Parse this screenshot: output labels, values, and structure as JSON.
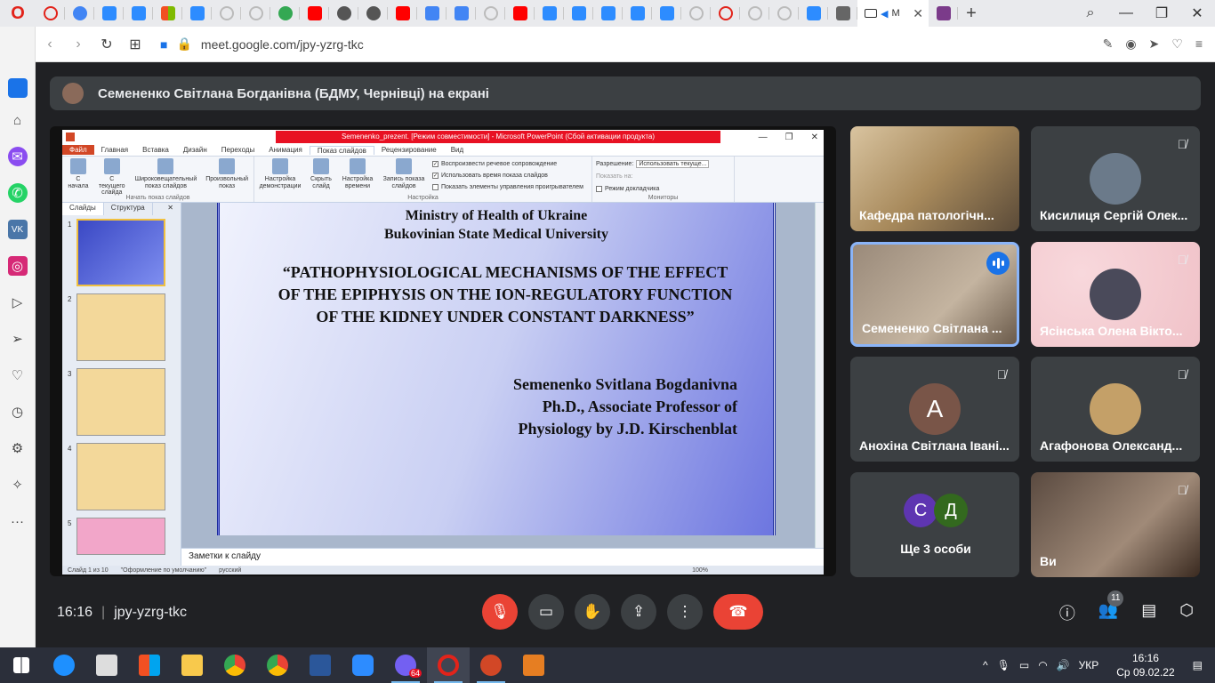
{
  "browser": {
    "active_tab_label": "М",
    "url": "meet.google.com/jpy-yzrg-tkc"
  },
  "meet": {
    "presenter_banner": "Семененко Світлана Богданівна (БДМУ, Чернівці) на екрані",
    "meeting_time": "16:16",
    "meeting_code": "jpy-yzrg-tkc",
    "participant_count": "11",
    "participants": [
      {
        "name": "Кафедра патологічн...",
        "avatar": "",
        "muted": false
      },
      {
        "name": "Кисилиця Сергій Олек...",
        "avatar": "",
        "muted": true
      },
      {
        "name": "Семененко Світлана ...",
        "avatar": "",
        "muted": false,
        "speaking": true
      },
      {
        "name": "Ясінська Олена Вікто...",
        "avatar": "",
        "muted": true
      },
      {
        "name": "Анохіна Світлана Івані...",
        "avatar": "А",
        "muted": true
      },
      {
        "name": "Агафонова Олександ...",
        "avatar": "",
        "muted": true
      },
      {
        "name": "Ще 3 особи",
        "avatar": "",
        "muted": false
      },
      {
        "name": "Ви",
        "avatar": "",
        "muted": true
      }
    ],
    "more_avatars": [
      "С",
      "Д"
    ]
  },
  "powerpoint": {
    "window_title": "Semenenko_prezent. [Режим совместимости] - Microsoft PowerPoint (Сбой активации продукта)",
    "menus": [
      "Файл",
      "Главная",
      "Вставка",
      "Дизайн",
      "Переходы",
      "Анимация",
      "Показ слайдов",
      "Рецензирование",
      "Вид"
    ],
    "ribbon_buttons": [
      "С начала",
      "С текущего слайда",
      "Широковещательный показ слайдов",
      "Произвольный показ",
      "Настройка демонстрации",
      "Скрыть слайд",
      "Настройка времени",
      "Запись показа слайдов"
    ],
    "ribbon_checks": [
      "Воспроизвести речевое сопровождение",
      "Использовать время показа слайдов",
      "Показать элементы управления проигрывателем"
    ],
    "group_start": "Начать показ слайдов",
    "group_setup": "Настройка",
    "group_monitors": "Мониторы",
    "resolution_label": "Разрешение:",
    "resolution_value": "Использовать текуще...",
    "show_on_label": "Показать на:",
    "presenter_mode": "Режим докладчика",
    "panel_tabs": [
      "Слайды",
      "Структура"
    ],
    "slide_numbers": [
      "1",
      "2",
      "3",
      "4",
      "5"
    ],
    "slide": {
      "institution_1": "Ministry of Health of Ukraine",
      "institution_2": "Bukovinian State Medical University",
      "title": "“PATHOPHYSIOLOGICAL MECHANISMS OF THE EFFECT OF THE EPIPHYSIS ON THE ION-REGULATORY FUNCTION OF THE KIDNEY UNDER CONSTANT DARKNESS”",
      "author_1": "Semenenko Svitlana Bogdanivna",
      "author_2": "Ph.D., Associate Professor of",
      "author_3": "Physiology by J.D. Kirschenblat"
    },
    "notes_placeholder": "Заметки к слайду",
    "status_slide": "Слайд 1 из 10",
    "status_theme": "\"Оформление по умолчанию\"",
    "status_lang": "русский",
    "zoom": "100%"
  },
  "taskbar": {
    "viber_badge": "64",
    "lang": "УКР",
    "time": "16:16",
    "date": "Ср 09.02.22"
  }
}
